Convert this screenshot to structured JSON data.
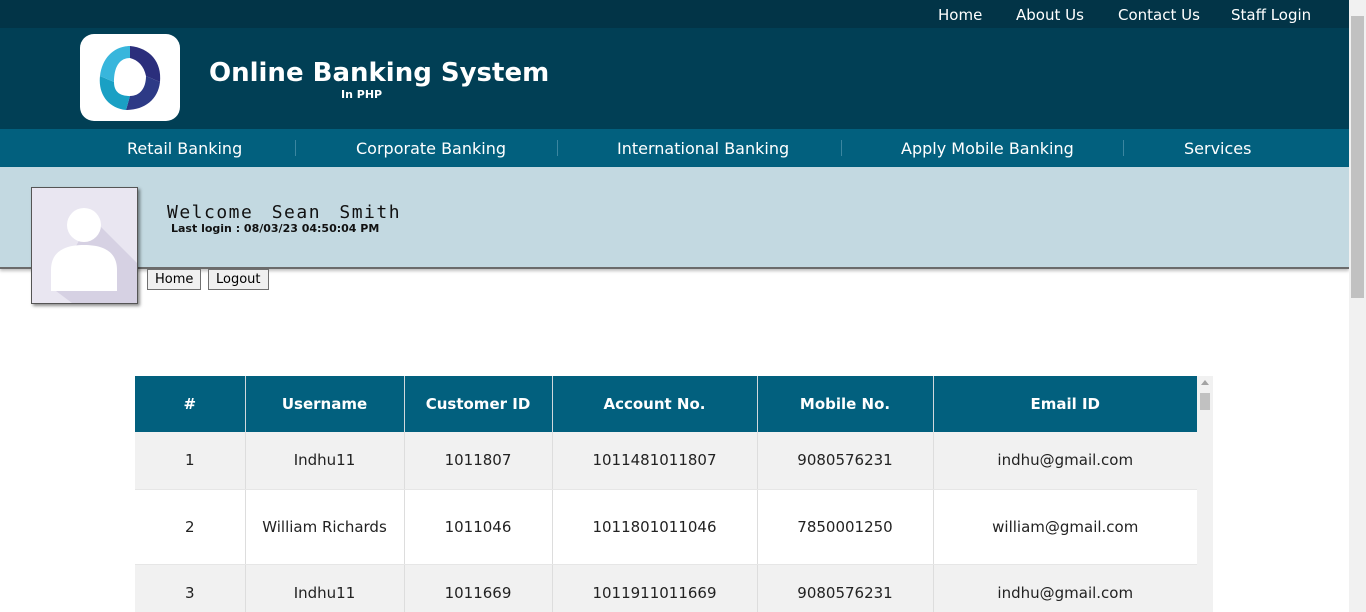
{
  "topnav": {
    "home": "Home",
    "about": "About Us",
    "contact": "Contact Us",
    "staff": "Staff Login"
  },
  "header": {
    "title": "Online Banking System",
    "subtitle": "In PHP"
  },
  "mainnav": [
    "Retail Banking",
    "Corporate Banking",
    "International Banking",
    "Apply Mobile Banking",
    "Services"
  ],
  "welcome": {
    "greeting": "Welcome  Sean  Smith",
    "last_login": "Last login : 08/03/23 04:50:04 PM"
  },
  "actions": {
    "home": "Home",
    "logout": "Logout"
  },
  "table": {
    "headers": [
      "#",
      "Username",
      "Customer ID",
      "Account No.",
      "Mobile No.",
      "Email ID"
    ],
    "rows": [
      [
        "1",
        "Indhu11",
        "1011807",
        "1011481011807",
        "9080576231",
        "indhu@gmail.com"
      ],
      [
        "2",
        "William Richards",
        "1011046",
        "1011801011046",
        "7850001250",
        "william@gmail.com"
      ],
      [
        "3",
        "Indhu11",
        "1011669",
        "1011911011669",
        "9080576231",
        "indhu@gmail.com"
      ]
    ]
  },
  "colors": {
    "topbar": "#023447",
    "header": "#013f55",
    "nav": "#02607e",
    "welcome_bg": "#c3d9e1"
  }
}
